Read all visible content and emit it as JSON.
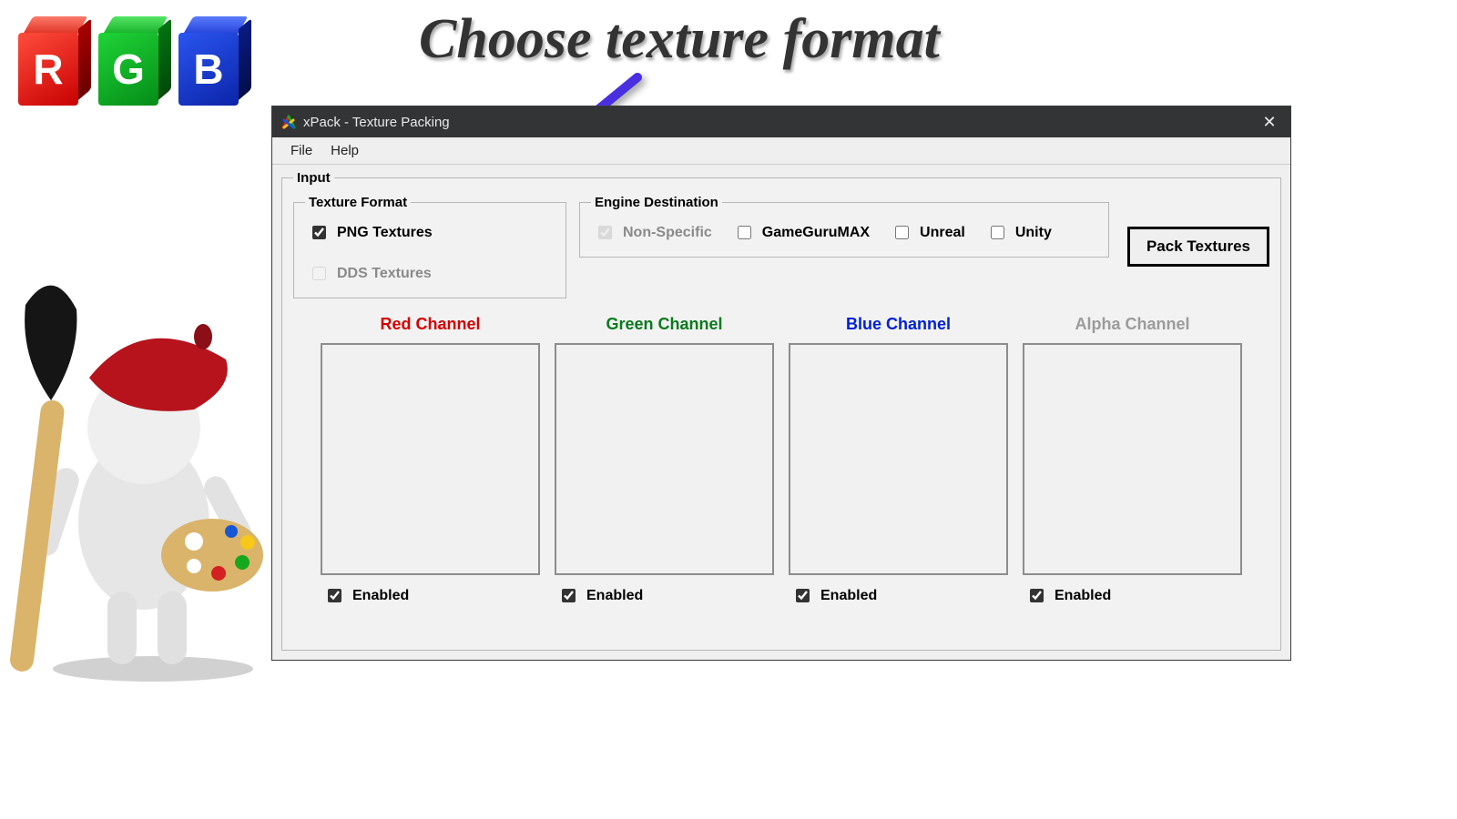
{
  "heading": "Choose texture format",
  "rgb_letters": [
    "R",
    "G",
    "B"
  ],
  "window": {
    "title": "xPack - Texture Packing",
    "menus": {
      "file": "File",
      "help": "Help"
    },
    "input_group": "Input",
    "texture_format": {
      "legend": "Texture Format",
      "png": {
        "label": "PNG Textures",
        "checked": true,
        "disabled": false
      },
      "dds": {
        "label": "DDS Textures",
        "checked": false,
        "disabled": true
      }
    },
    "engine_destination": {
      "legend": "Engine Destination",
      "non_specific": {
        "label": "Non-Specific",
        "checked": true,
        "disabled": true
      },
      "gamegurumax": {
        "label": "GameGuruMAX",
        "checked": false,
        "disabled": false
      },
      "unreal": {
        "label": "Unreal",
        "checked": false,
        "disabled": false
      },
      "unity": {
        "label": "Unity",
        "checked": false,
        "disabled": false
      }
    },
    "pack_button": "Pack Textures",
    "channels": {
      "enabled_label": "Enabled",
      "red": {
        "title": "Red Channel",
        "enabled": true
      },
      "green": {
        "title": "Green Channel",
        "enabled": true
      },
      "blue": {
        "title": "Blue Channel",
        "enabled": true
      },
      "alpha": {
        "title": "Alpha Channel",
        "enabled": true
      }
    }
  }
}
